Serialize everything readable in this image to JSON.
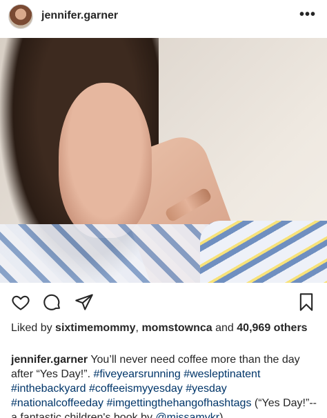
{
  "header": {
    "username": "jennifer.garner",
    "more_glyph": "•••"
  },
  "post": {
    "photo_alt": "selfie photo"
  },
  "actions": {
    "like": "heart-icon",
    "comment": "comment-icon",
    "share": "share-icon",
    "save": "bookmark-icon"
  },
  "likes": {
    "prefix": "Liked by ",
    "user1": "sixtimemommy",
    "sep": ", ",
    "user2": "momstownca",
    "and": " and ",
    "count": "40,969",
    "suffix": "others"
  },
  "caption": {
    "username": "jennifer.garner",
    "text1": " You’ll never need coffee more than the day after “Yes Day!”. ",
    "tag1": "#fiveyearsrunning",
    "tag2": "#wesleptinatent",
    "tag3": "#inthebackyard",
    "tag4": "#coffeeismyyesday",
    "tag5": "#yesday",
    "tag6": "#nationalcoffeeday",
    "tag7": "#imgettingthehangofhashtags",
    "text2": " (“Yes Day!”-- a fantastic children's book by ",
    "mention": "@missamykr",
    "text3": ")"
  }
}
